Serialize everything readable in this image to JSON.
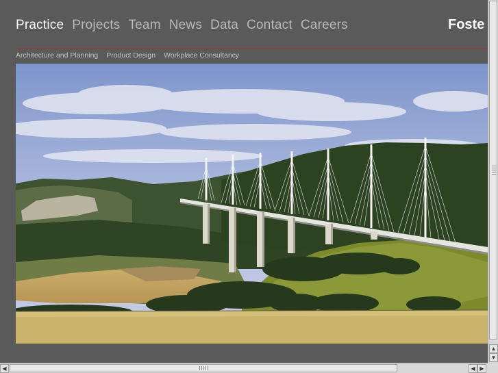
{
  "nav": {
    "items": [
      {
        "label": "Practice",
        "active": true
      },
      {
        "label": "Projects"
      },
      {
        "label": "Team"
      },
      {
        "label": "News"
      },
      {
        "label": "Data"
      },
      {
        "label": "Contact"
      },
      {
        "label": "Careers"
      }
    ]
  },
  "logo": {
    "text": "Foste"
  },
  "subnav": {
    "items": [
      {
        "label": "Architecture and Planning"
      },
      {
        "label": "Product Design"
      },
      {
        "label": "Workplace Consultancy"
      }
    ]
  },
  "colors": {
    "background": "#5a5a5a",
    "nav_active": "#ffffff",
    "nav_inactive": "#b9b9b9",
    "rule": "#b03030"
  },
  "scrollbars": {
    "up_arrow": "▲",
    "down_arrow": "▼",
    "left_arrow": "◀",
    "right_arrow": "▶"
  }
}
